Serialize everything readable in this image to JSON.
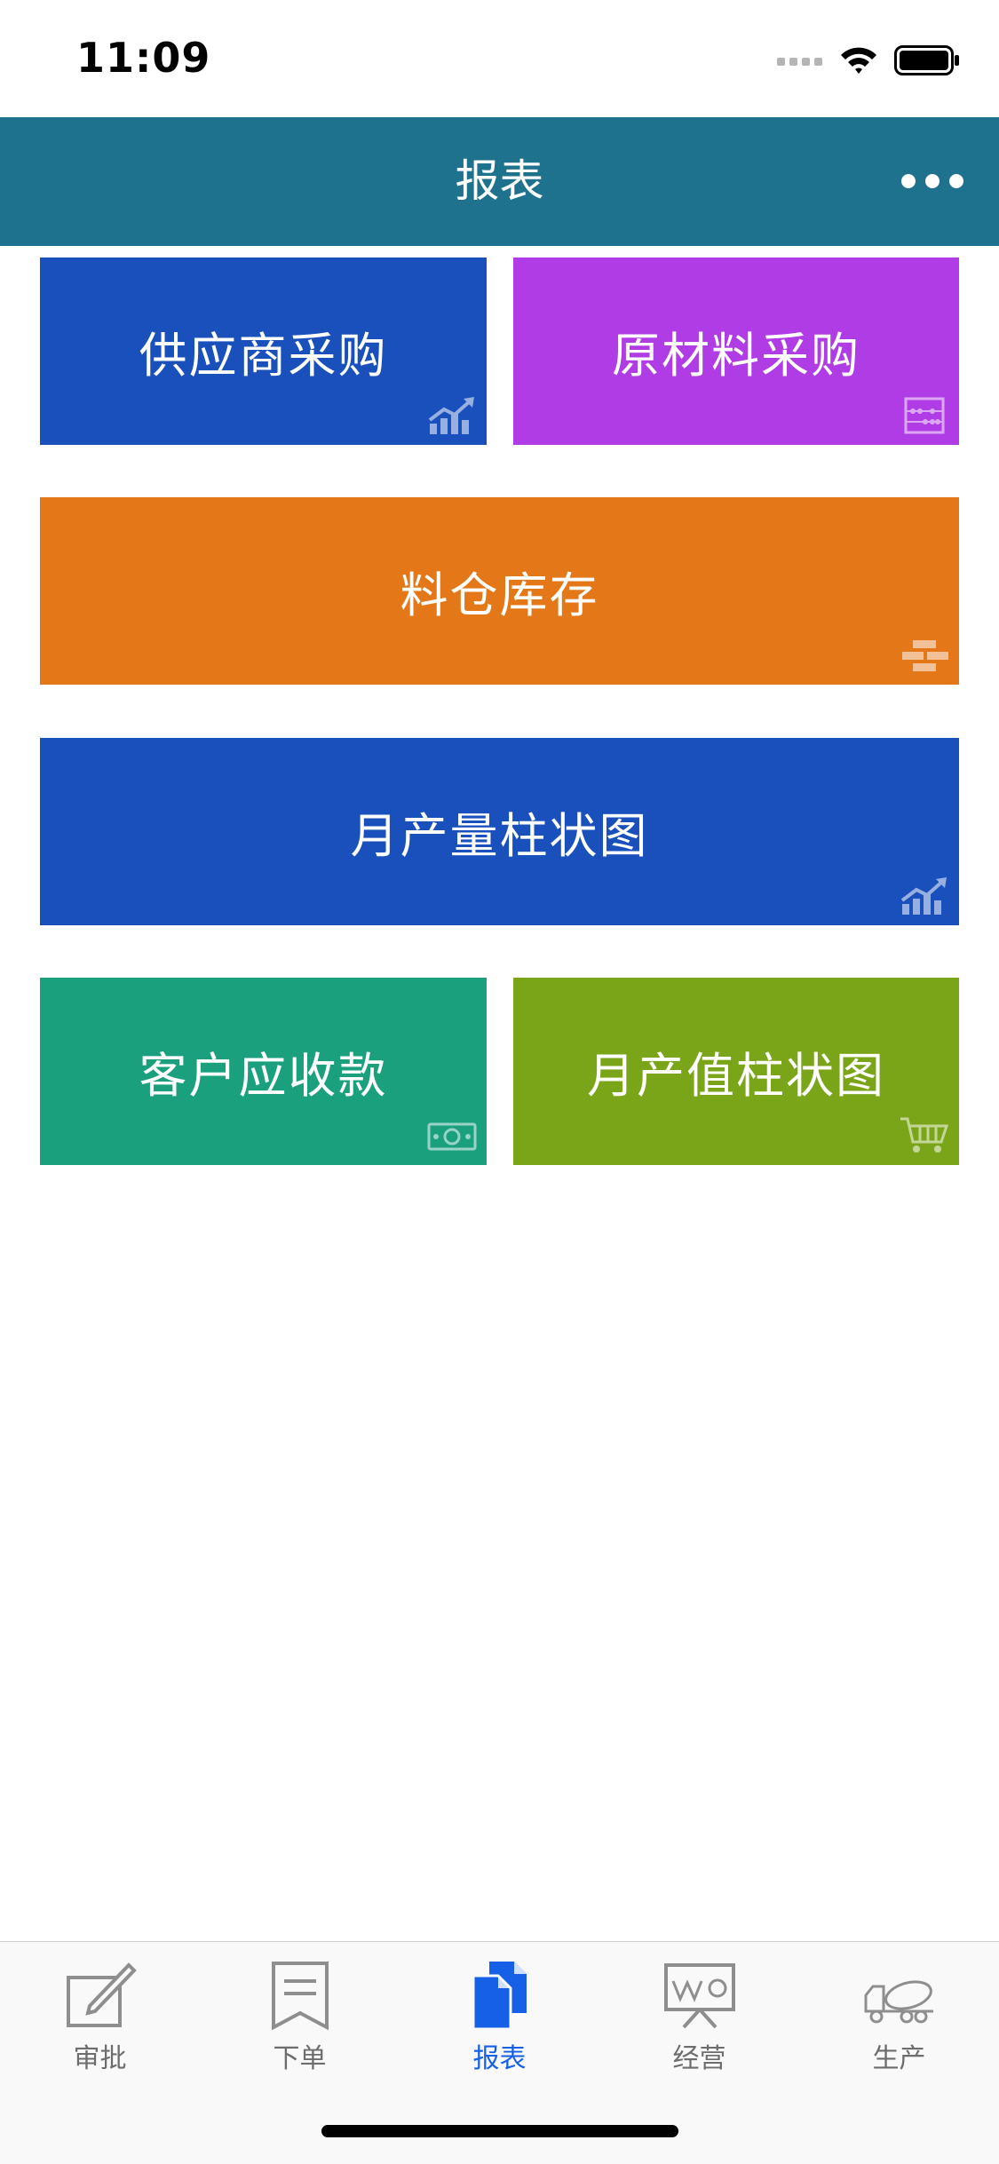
{
  "status_bar": {
    "time": "11:09"
  },
  "nav": {
    "title": "报表"
  },
  "tiles": [
    {
      "label": "供应商采购",
      "color": "#1a50bc",
      "icon": "chart-up-icon"
    },
    {
      "label": "原材料采购",
      "color": "#b03ce6",
      "icon": "abacus-icon"
    },
    {
      "label": "料仓库存",
      "color": "#e47718",
      "icon": "bricks-icon"
    },
    {
      "label": "月产量柱状图",
      "color": "#1a50bc",
      "icon": "chart-up-icon"
    },
    {
      "label": "客户应收款",
      "color": "#1ba07e",
      "icon": "money-icon"
    },
    {
      "label": "月产值柱状图",
      "color": "#7aa519",
      "icon": "cart-icon"
    }
  ],
  "tabs": [
    {
      "label": "审批",
      "icon": "edit-icon",
      "active": false
    },
    {
      "label": "下单",
      "icon": "bookmark-icon",
      "active": false
    },
    {
      "label": "报表",
      "icon": "documents-icon",
      "active": true
    },
    {
      "label": "经营",
      "icon": "presentation-icon",
      "active": false
    },
    {
      "label": "生产",
      "icon": "mixer-truck-icon",
      "active": false
    }
  ],
  "colors": {
    "nav_bg": "#1e728e",
    "tab_active": "#1660e8",
    "tab_inactive": "#6d6d6d"
  }
}
